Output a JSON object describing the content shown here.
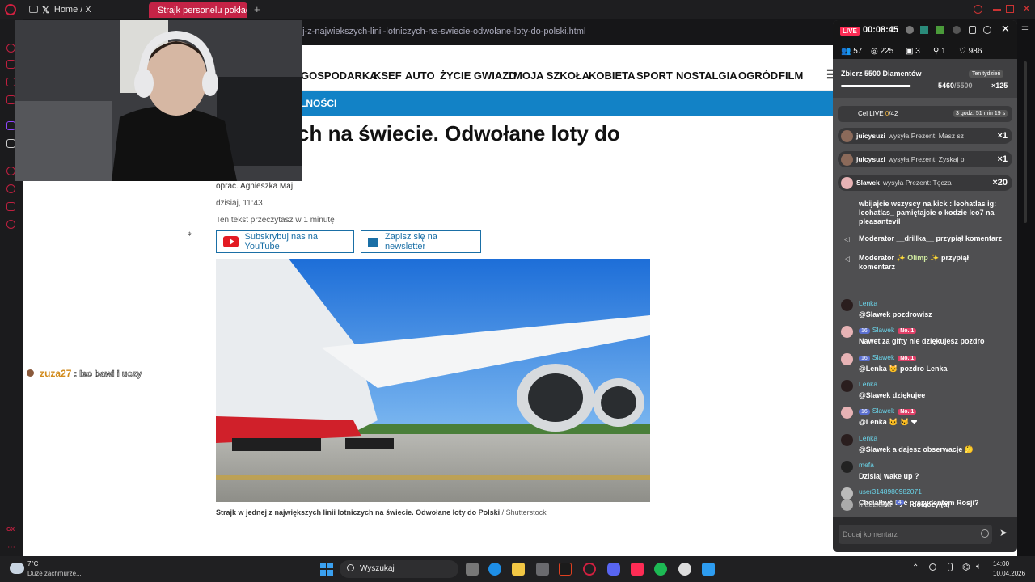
{
  "browser": {
    "tab1_title": "Home / X",
    "tab2_title": "Strajk personelu pokładow",
    "new_tab": "+",
    "url": "ej-z-najwiekszych-linii-lotniczych-na-swiecie-odwolane-loty-do-polski.html"
  },
  "site": {
    "nav": [
      "GOSPODARKA",
      "KSEF",
      "AUTO",
      "ŻYCIE GWIAZD",
      "MOJA SZKOŁA",
      "KOBIETA",
      "SPORT",
      "NOSTALGIA",
      "OGRÓD",
      "FILM"
    ],
    "bluebar_label": "LNOŚCI"
  },
  "article": {
    "headline": "ch na świecie. Odwołane loty do",
    "author": "oprac. Agnieszka Maj",
    "date": "dzisiaj, 11:43",
    "read_time": "Ten tekst przeczytasz w 1 minutę",
    "youtube_btn": "Subskrybuj nas na YouTube",
    "newsletter_btn": "Zapisz się na newsletter",
    "caption": "Strajk w jednej z największych linii lotniczych na świecie. Odwołane loty do Polski",
    "caption_source": "/ Shutterstock"
  },
  "overlay_chat": {
    "user": "zuza27",
    "text": ": leo bawi i uczy"
  },
  "live": {
    "badge": "LIVE",
    "time": "00:08:45",
    "stats": [
      "57",
      "225",
      "3",
      "1",
      "986"
    ],
    "goal_title": "Zbierz 5500 Diamentów",
    "goal_period": "Ten tydzień",
    "goal_progress": "5460",
    "goal_total": "/5500",
    "goal_multiplier": "×125",
    "goal_fraction": 0.993,
    "cel_label": "Cel LIVE",
    "cel_value": "0",
    "cel_total": "/42",
    "cel_timer": "3 godz. 51 min 19 s",
    "gifts": [
      {
        "user": "juicysuzi",
        "text": "wysyła Prezent: Masz sz",
        "count": "×1"
      },
      {
        "user": "juicysuzi",
        "text": "wysyła Prezent: Zyskaj p",
        "count": "×1"
      },
      {
        "user": "Slawek",
        "text": "wysyła Prezent: Tęcza",
        "count": "×20"
      }
    ],
    "pinned_fragment": "wbijajcie wszyscy na kick : leohatlas ig: leohatlas_ pamiętajcie o kodzie leo7 na pleasantevil",
    "mod_pin_1": "Moderator __drillka__ przypiął komentarz",
    "mod_pin_2_a": "Moderator",
    "mod_pin_2_b": "Olimp",
    "mod_pin_2_c": "przypiął komentarz",
    "messages": [
      {
        "user": "Lenka",
        "text": "@Slawek pozdrowisz"
      },
      {
        "user": "Slawek",
        "level": "16",
        "badge": "No. 1",
        "text": "Nawet za gifty nie dziękujesz pozdro"
      },
      {
        "user": "Slawek",
        "level": "16",
        "badge": "No. 1",
        "text": "@Lenka 🐱 pozdro Lenka"
      },
      {
        "user": "Lenka",
        "text": "@Slawek dziękujee"
      },
      {
        "user": "Slawek",
        "level": "16",
        "badge": "No. 1",
        "text": "@Lenka 🐱 🐱 ❤"
      },
      {
        "user": "Lenka",
        "text": "@Slawek a dajesz obserwacje 🤔"
      },
      {
        "user": "mefa",
        "text": "Dzisiaj wake up ?"
      },
      {
        "user": "user3148980982071",
        "text": "Chciałbyś być prezydentem Rosji?"
      }
    ],
    "joined_user": "madziulka",
    "joined_level": "4",
    "joined_text": "dołączył(a)",
    "comment_placeholder": "Dodaj komentarz"
  },
  "taskbar": {
    "weather_temp": "7°C",
    "weather_desc": "Duże zachmurze...",
    "search": "Wyszukaj",
    "time": "14:00",
    "date": "10.04.2026"
  },
  "colors": {
    "accent_red": "#c42346",
    "blue_bar": "#1282c6",
    "live_pink": "#fe2c55"
  }
}
